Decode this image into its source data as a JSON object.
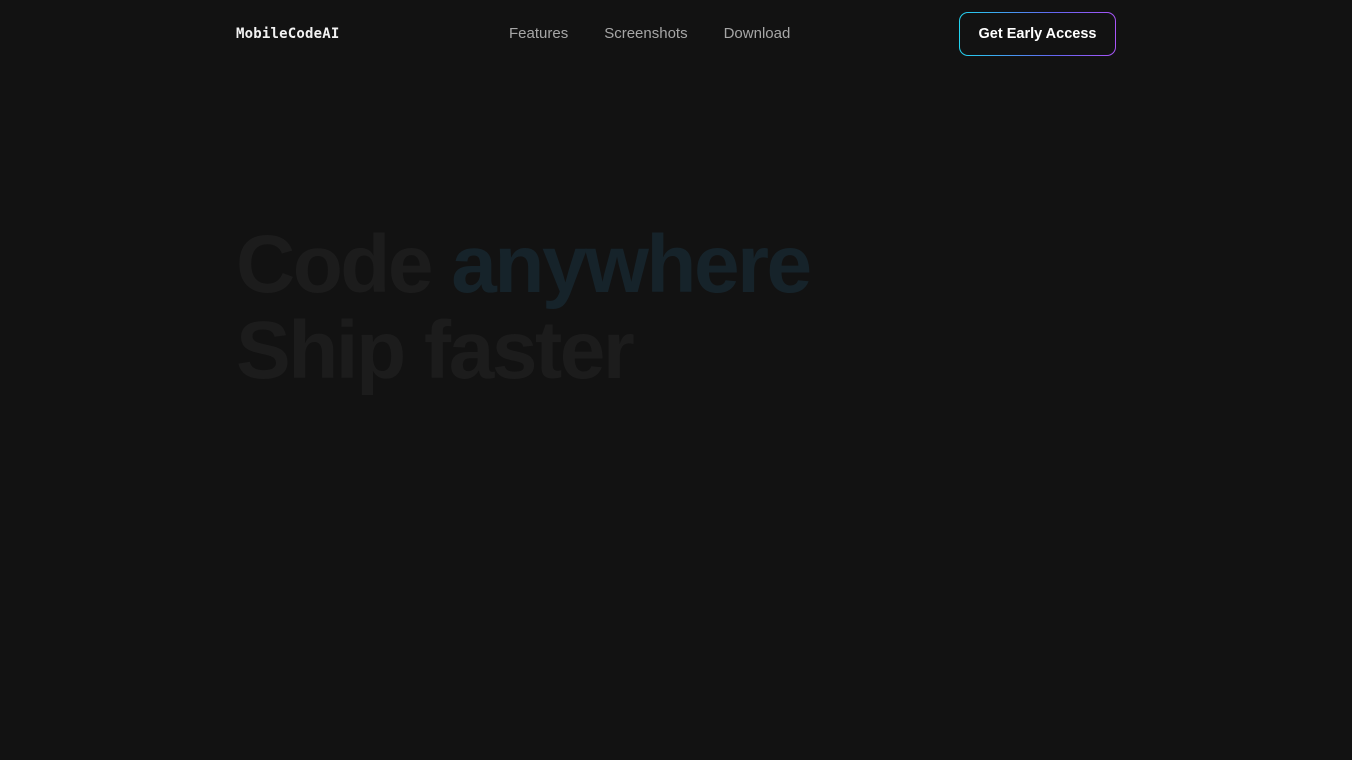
{
  "nav": {
    "logo": "MobileCodeAI",
    "links": [
      {
        "label": "Features"
      },
      {
        "label": "Screenshots"
      },
      {
        "label": "Download"
      }
    ],
    "cta_label": "Get Early Access"
  },
  "hero": {
    "line1_prefix": "Code",
    "line1_accent": "anywhere",
    "line2": "Ship faster"
  },
  "colors": {
    "background": "#121212",
    "cta_gradient_start": "#22d3ee",
    "cta_gradient_end": "#a855f7",
    "nav_link": "#a6a6a6"
  }
}
